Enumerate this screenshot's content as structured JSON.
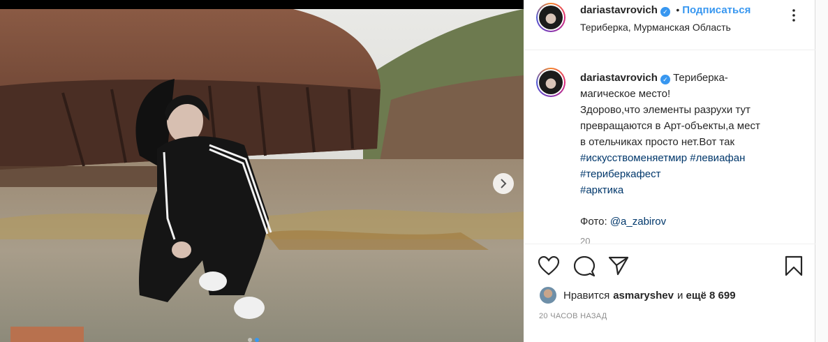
{
  "header": {
    "username": "dariastavrovich",
    "separator": "•",
    "follow_label": "Подписаться",
    "location": "Териберка, Мурманская Область"
  },
  "caption": {
    "username": "dariastavrovich",
    "lines": [
      "Териберка-",
      "магическое место!",
      "Здорово,что элементы разрухи тут",
      "превращаются в Арт-объекты,а мест",
      "в отельчиках просто нет.Вот так"
    ],
    "hashtags_line1": [
      "#искусствоменяетмир",
      "#левиафан"
    ],
    "hashtags_line2": "#териберкафест",
    "hashtags_line3": "#арктика",
    "photo_label": "Фото:",
    "photo_credit": "@a_zabirov",
    "cut_text": "20"
  },
  "likes": {
    "prefix": "Нравится",
    "user": "asmaryshev",
    "middle": "и",
    "count": "ещё 8 699"
  },
  "timestamp": "20 ЧАСОВ НАЗАД",
  "icons": {
    "like": "heart-icon",
    "comment": "comment-icon",
    "share": "paper-plane-icon",
    "save": "bookmark-icon",
    "more": "more-options-icon",
    "next": "chevron-right-icon",
    "verified": "verified-badge-icon"
  },
  "colors": {
    "link": "#3897f0",
    "hashtag": "#00376b",
    "text": "#262626",
    "muted": "#8e8e8e"
  },
  "carousel": {
    "count": 2,
    "active_index": 1
  }
}
